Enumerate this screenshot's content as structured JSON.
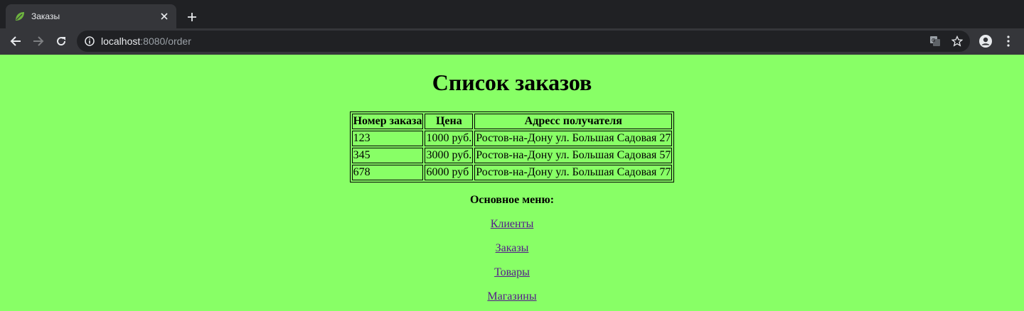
{
  "browser": {
    "tab_title": "Заказы",
    "url_host": "localhost",
    "url_path": ":8080/order"
  },
  "page": {
    "heading": "Список заказов",
    "table": {
      "headers": [
        "Номер заказа",
        "Цена",
        "Адресс получателя"
      ],
      "rows": [
        [
          "123",
          "1000 руб.",
          "Ростов-на-Дону ул. Большая Садовая 27"
        ],
        [
          "345",
          "3000 руб.",
          "Ростов-на-Дону ул. Большая Садовая 57"
        ],
        [
          "678",
          "6000 руб",
          "Ростов-на-Дону ул. Большая Садовая 77"
        ]
      ]
    },
    "menu": {
      "title": "Основное меню:",
      "links": [
        "Клиенты",
        "Заказы",
        "Товары",
        "Магазины"
      ]
    }
  }
}
